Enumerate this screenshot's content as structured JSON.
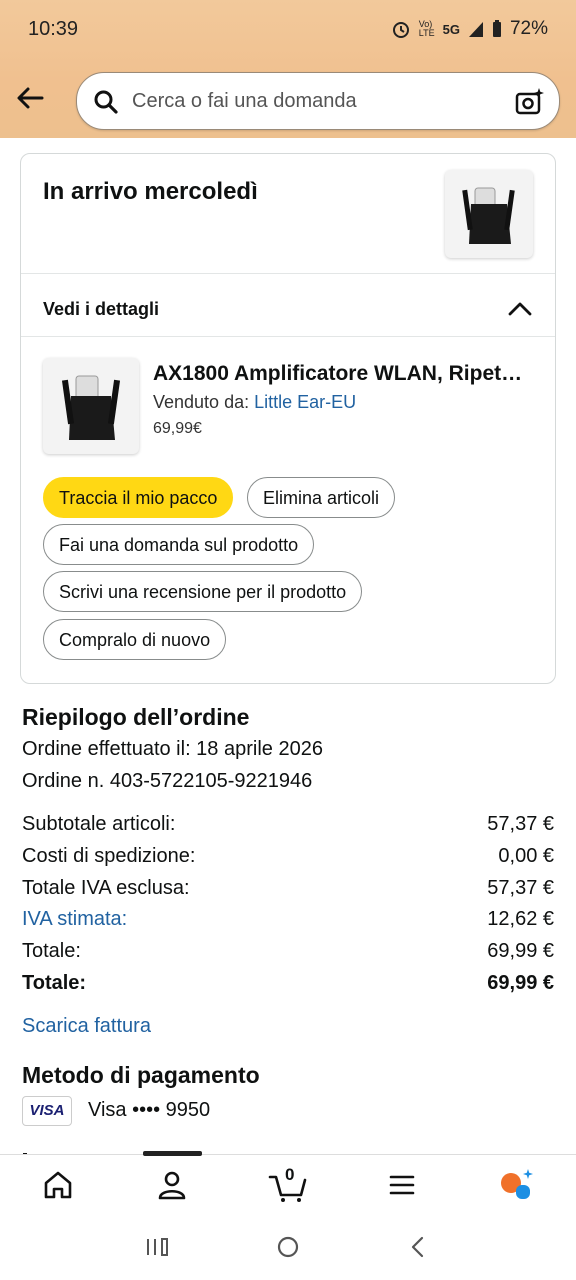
{
  "status_bar": {
    "time": "10:39",
    "network": "5G",
    "battery": "72%"
  },
  "header": {
    "search_placeholder": "Cerca o fai una domanda"
  },
  "delivery_card": {
    "title": "In arrivo mercoledì",
    "details_label": "Vedi i dettagli",
    "product": {
      "name": "AX1800 Amplificatore WLAN, Ripet…",
      "seller_label": "Venduto da:",
      "seller_name": "Little Ear-EU",
      "price": "69,99€"
    },
    "actions": {
      "track": "Traccia il mio pacco",
      "delete": "Elimina articoli",
      "ask": "Fai una domanda sul prodotto",
      "review": "Scrivi una recensione per il prodotto",
      "buy_again": "Compralo di nuovo"
    }
  },
  "order_summary": {
    "title": "Riepilogo dell’ordine",
    "placed_on": "Ordine effettuato il: 18 aprile 2026",
    "order_number": "Ordine n. 403-5722105-9221946",
    "rows": [
      {
        "label": "Subtotale articoli:",
        "value": "57,37 €"
      },
      {
        "label": "Costi di spedizione:",
        "value": "0,00 €"
      },
      {
        "label": "Totale IVA esclusa:",
        "value": "57,37 €"
      },
      {
        "label": "IVA stimata:",
        "value": "12,62 €"
      },
      {
        "label": "Totale:",
        "value": "69,99 €"
      },
      {
        "label": "Totale:",
        "value": "69,99 €"
      }
    ],
    "invoice_link": "Scarica fattura"
  },
  "payment": {
    "title": "Metodo di pagamento",
    "card_brand": "VISA",
    "card_text": "Visa •••• 9950"
  },
  "bottom_nav": {
    "cart_count": "0"
  },
  "colors": {
    "header_bg": "#f0c08f",
    "primary_button": "#ffd814",
    "link": "#2162a1"
  }
}
